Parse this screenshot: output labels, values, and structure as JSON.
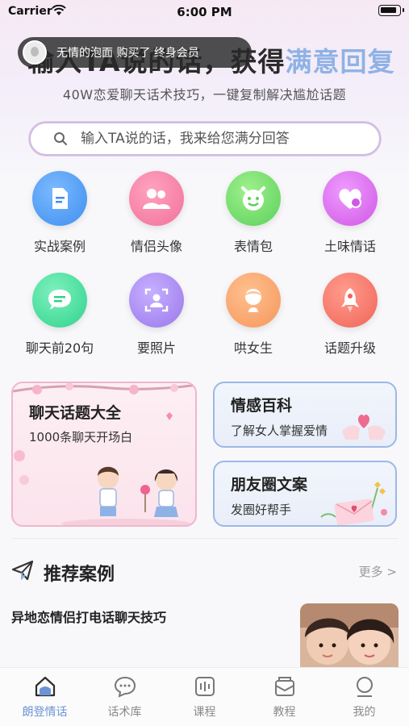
{
  "status_bar": {
    "carrier": "Carrier",
    "time": "6:00 PM"
  },
  "hero": {
    "title_start": "输入TA说的话，获得",
    "title_accent": "满意回复",
    "subtitle": "40W恋爱聊天话术技巧，一键复制解决尴尬话题"
  },
  "toast": {
    "text": "无情的泡面  购买了 终身会员"
  },
  "search": {
    "placeholder": "输入TA说的话，我来给您满分回答",
    "value": ""
  },
  "grid": [
    {
      "label": "实战案例",
      "icon": "document-icon",
      "color": "#3f8ff0"
    },
    {
      "label": "情侣头像",
      "icon": "couple-icon",
      "color": "#f2709a"
    },
    {
      "label": "表情包",
      "icon": "devil-face-icon",
      "color": "#5bd05a"
    },
    {
      "label": "土味情话",
      "icon": "heart-icon",
      "color": "#d057e6"
    },
    {
      "label": "聊天前20句",
      "icon": "chat-bubble-icon",
      "color": "#2fd38c"
    },
    {
      "label": "要照片",
      "icon": "photo-icon",
      "color": "#9a77ea"
    },
    {
      "label": "哄女生",
      "icon": "girl-icon",
      "color": "#f5965b"
    },
    {
      "label": "话题升级",
      "icon": "rocket-icon",
      "color": "#f06458"
    }
  ],
  "cards": {
    "topics": {
      "title": "聊天话题大全",
      "subtitle": "1000条聊天开场白"
    },
    "emotion": {
      "title": "情感百科",
      "subtitle": "了解女人掌握爱情"
    },
    "moments": {
      "title": "朋友圈文案",
      "subtitle": "发圈好帮手"
    }
  },
  "recommend": {
    "title": "推荐案例",
    "more": "更多 >",
    "first_title": "异地恋情侣打电话聊天技巧"
  },
  "tabs": [
    {
      "label": "朗登情话",
      "icon": "home-icon",
      "active": true
    },
    {
      "label": "话术库",
      "icon": "chat-icon",
      "active": false
    },
    {
      "label": "课程",
      "icon": "course-icon",
      "active": false
    },
    {
      "label": "教程",
      "icon": "tutorial-icon",
      "active": false
    },
    {
      "label": "我的",
      "icon": "profile-icon",
      "active": false
    }
  ],
  "colors": {
    "accent": "#8fb2e6",
    "tab_active": "#6c93d6",
    "pink_border": "#f2b5cb",
    "blue_border": "#9cb8e6"
  }
}
